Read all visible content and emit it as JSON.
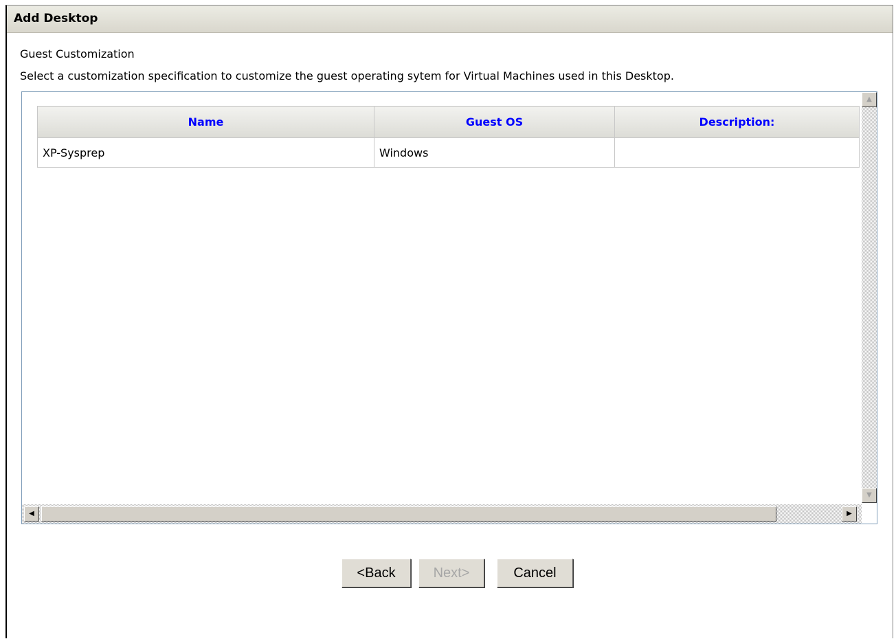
{
  "window": {
    "title": "Add Desktop"
  },
  "page": {
    "section_title": "Guest Customization",
    "instructions": "Select a customization specification to customize the guest operating sytem for Virtual Machines used in this Desktop."
  },
  "table": {
    "headers": [
      "Name",
      "Guest OS",
      "Description:"
    ],
    "rows": [
      {
        "name": "XP-Sysprep",
        "guest_os": "Windows",
        "description": ""
      }
    ]
  },
  "buttons": {
    "back": {
      "label": "<Back",
      "enabled": true
    },
    "next": {
      "label": "Next>",
      "enabled": false
    },
    "cancel": {
      "label": "Cancel",
      "enabled": true
    }
  },
  "colors": {
    "header_text": "#0000ff",
    "titlebar_bg": "#d9d7cd"
  },
  "icons": {
    "scroll_up": "arrow-up-icon",
    "scroll_down": "arrow-down-icon",
    "scroll_left": "arrow-left-icon",
    "scroll_right": "arrow-right-icon"
  }
}
